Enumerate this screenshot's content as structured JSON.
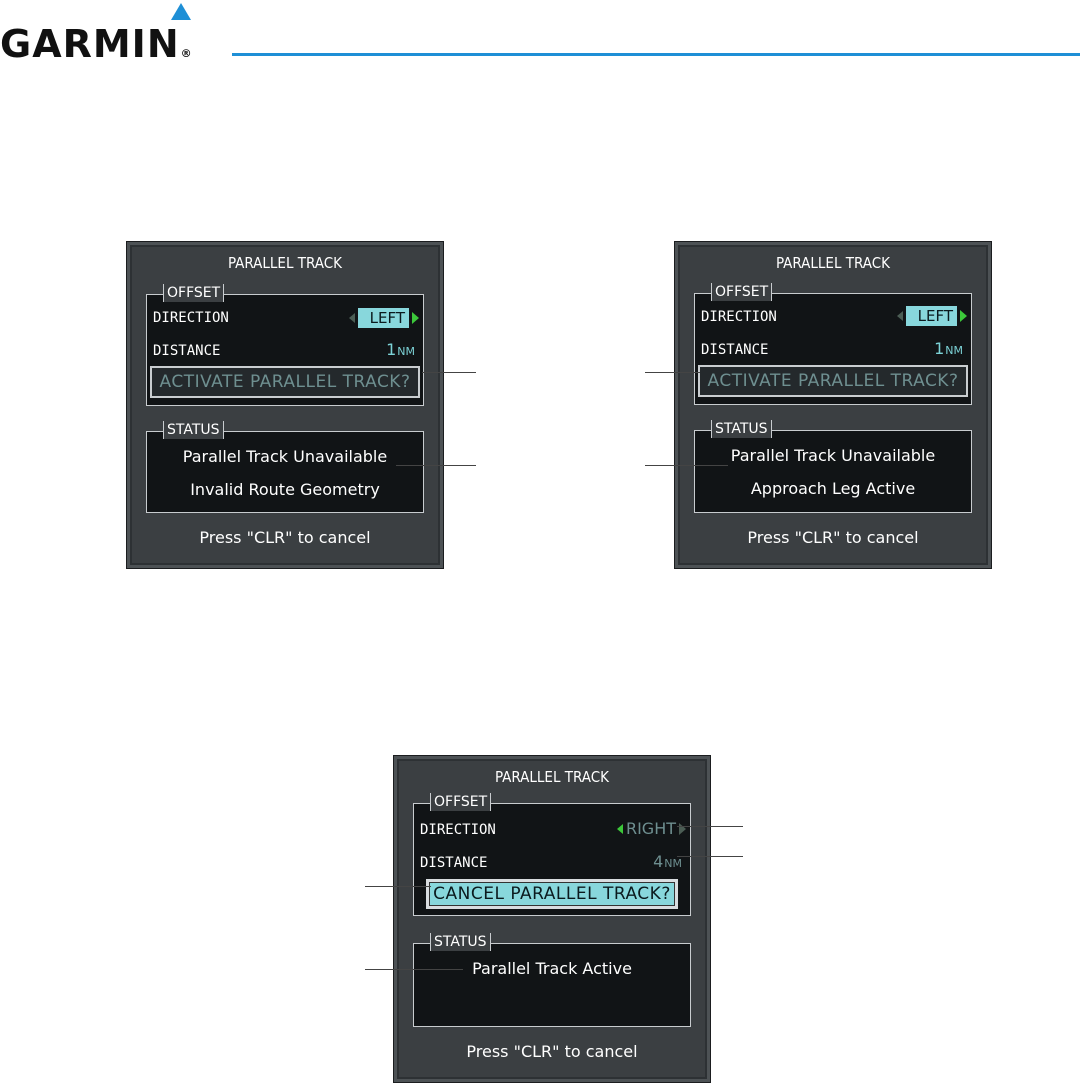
{
  "header": {
    "brand": "GARMIN",
    "reg_mark": "®"
  },
  "windows": [
    {
      "title": "PARALLEL TRACK",
      "offset_label": "OFFSET",
      "direction_label": "DIRECTION",
      "direction_value": "LEFT",
      "distance_label": "DISTANCE",
      "distance_value": "1",
      "distance_unit": "NM",
      "action": "ACTIVATE PARALLEL TRACK?",
      "status_label": "STATUS",
      "status_lines": [
        "Parallel Track Unavailable",
        "Invalid Route Geometry"
      ],
      "footer": "Press \"CLR\" to cancel"
    },
    {
      "title": "PARALLEL TRACK",
      "offset_label": "OFFSET",
      "direction_label": "DIRECTION",
      "direction_value": "LEFT",
      "distance_label": "DISTANCE",
      "distance_value": "1",
      "distance_unit": "NM",
      "action": "ACTIVATE PARALLEL TRACK?",
      "status_label": "STATUS",
      "status_lines": [
        "Parallel Track Unavailable",
        "Approach Leg Active"
      ],
      "footer": "Press \"CLR\" to cancel"
    },
    {
      "title": "PARALLEL TRACK",
      "offset_label": "OFFSET",
      "direction_label": "DIRECTION",
      "direction_value": "RIGHT",
      "distance_label": "DISTANCE",
      "distance_value": "4",
      "distance_unit": "NM",
      "action": "CANCEL PARALLEL TRACK?",
      "status_label": "STATUS",
      "status_lines": [
        "Parallel Track Active"
      ],
      "footer": "Press \"CLR\" to cancel"
    }
  ],
  "colors": {
    "garmin_blue": "#1e8fd6",
    "cyan_highlight": "#88d7dc",
    "dim_cyan": "#6e8f90",
    "arrow_green": "#3cc83a",
    "window_bg": "#3b3f42"
  }
}
